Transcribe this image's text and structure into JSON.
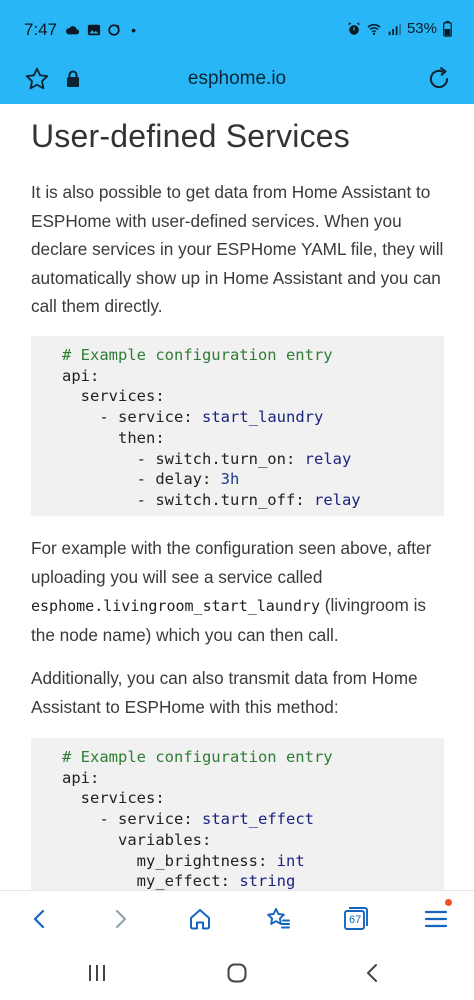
{
  "status_bar": {
    "time": "7:47",
    "dot": "•",
    "battery": "53%",
    "icons_left": [
      "cloud-icon",
      "gallery-icon",
      "sync-icon"
    ],
    "icons_right": [
      "alarm-icon",
      "wifi-icon",
      "signal-icon",
      "battery-icon"
    ]
  },
  "browser": {
    "url": "esphome.io",
    "icons": [
      "star-icon",
      "lock-icon",
      "reload-icon"
    ]
  },
  "article": {
    "heading": "User-defined Services",
    "para1": "It is also possible to get data from Home Assistant to ESPHome with user-defined services. When you declare services in your ESPHome YAML file, they will automatically show up in Home Assistant and you can call them directly.",
    "para2_before": "For example with the configuration seen above, after uploading you will see a service called ",
    "para2_code": "esphome.livingroom_start_laundry",
    "para2_after": " (livingroom is the node name) which you can then call.",
    "para3": "Additionally, you can also transmit data from Home Assistant to ESPHome with this method:",
    "code1": {
      "comment": "# Example configuration entry",
      "api": "api",
      "services": "services",
      "service_key": "service",
      "service_val": "start_laundry",
      "then": "then",
      "item1_key": "switch.turn_on",
      "item1_val": "relay",
      "item2_key": "delay",
      "item2_val": "3h",
      "item3_key": "switch.turn_off",
      "item3_val": "relay"
    },
    "code2": {
      "comment": "# Example configuration entry",
      "api": "api",
      "services": "services",
      "service_key": "service",
      "service_val": "start_effect",
      "variables": "variables",
      "var1_key": "my_brightness",
      "var1_val": "int",
      "var2_key": "my_effect",
      "var2_val": "string"
    }
  },
  "toolbar": {
    "tab_count": "67",
    "icons": [
      "back-icon",
      "forward-icon",
      "home-icon",
      "bookmarks-icon",
      "tabs-icon",
      "menu-icon"
    ]
  },
  "nav": {
    "icons": [
      "recents-icon",
      "home-nav-icon",
      "back-nav-icon"
    ]
  },
  "colors": {
    "header": "#29b6f6",
    "comment": "#2e7d32",
    "value": "#1a237e",
    "code_bg": "#f1f1f1"
  }
}
